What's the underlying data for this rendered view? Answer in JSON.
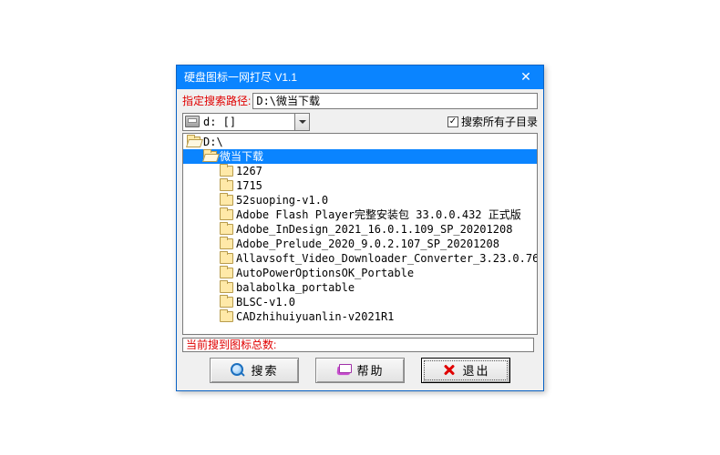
{
  "window": {
    "title": "硬盘图标一网打尽 V1.1"
  },
  "labels": {
    "path_label": "指定搜索路径:",
    "subdir_label": "搜索所有子目录",
    "status_prefix": "当前搜到图标总数:"
  },
  "inputs": {
    "path_value": "D:\\微当下载",
    "drive_text": "d: []",
    "subdir_checked": "✓"
  },
  "tree": {
    "root": {
      "label": "D:\\",
      "level": 0,
      "open": true,
      "selected": false
    },
    "items": [
      {
        "label": "微当下载",
        "level": 1,
        "open": true,
        "selected": true
      },
      {
        "label": "1267",
        "level": 2,
        "open": false,
        "selected": false
      },
      {
        "label": "1715",
        "level": 2,
        "open": false,
        "selected": false
      },
      {
        "label": "52suoping-v1.0",
        "level": 2,
        "open": false,
        "selected": false
      },
      {
        "label": "Adobe Flash Player完整安装包 33.0.0.432 正式版",
        "level": 2,
        "open": false,
        "selected": false
      },
      {
        "label": "Adobe_InDesign_2021_16.0.1.109_SP_20201208",
        "level": 2,
        "open": false,
        "selected": false
      },
      {
        "label": "Adobe_Prelude_2020_9.0.2.107_SP_20201208",
        "level": 2,
        "open": false,
        "selected": false
      },
      {
        "label": "Allavsoft_Video_Downloader_Converter_3.23.0.76",
        "level": 2,
        "open": false,
        "selected": false
      },
      {
        "label": "AutoPowerOptionsOK_Portable",
        "level": 2,
        "open": false,
        "selected": false
      },
      {
        "label": "balabolka_portable",
        "level": 2,
        "open": false,
        "selected": false
      },
      {
        "label": "BLSC-v1.0",
        "level": 2,
        "open": false,
        "selected": false
      },
      {
        "label": "CADzhihuiyuanlin-v2021R1",
        "level": 2,
        "open": false,
        "selected": false
      }
    ]
  },
  "buttons": {
    "search": "搜索",
    "help": "帮助",
    "exit": "退出"
  }
}
